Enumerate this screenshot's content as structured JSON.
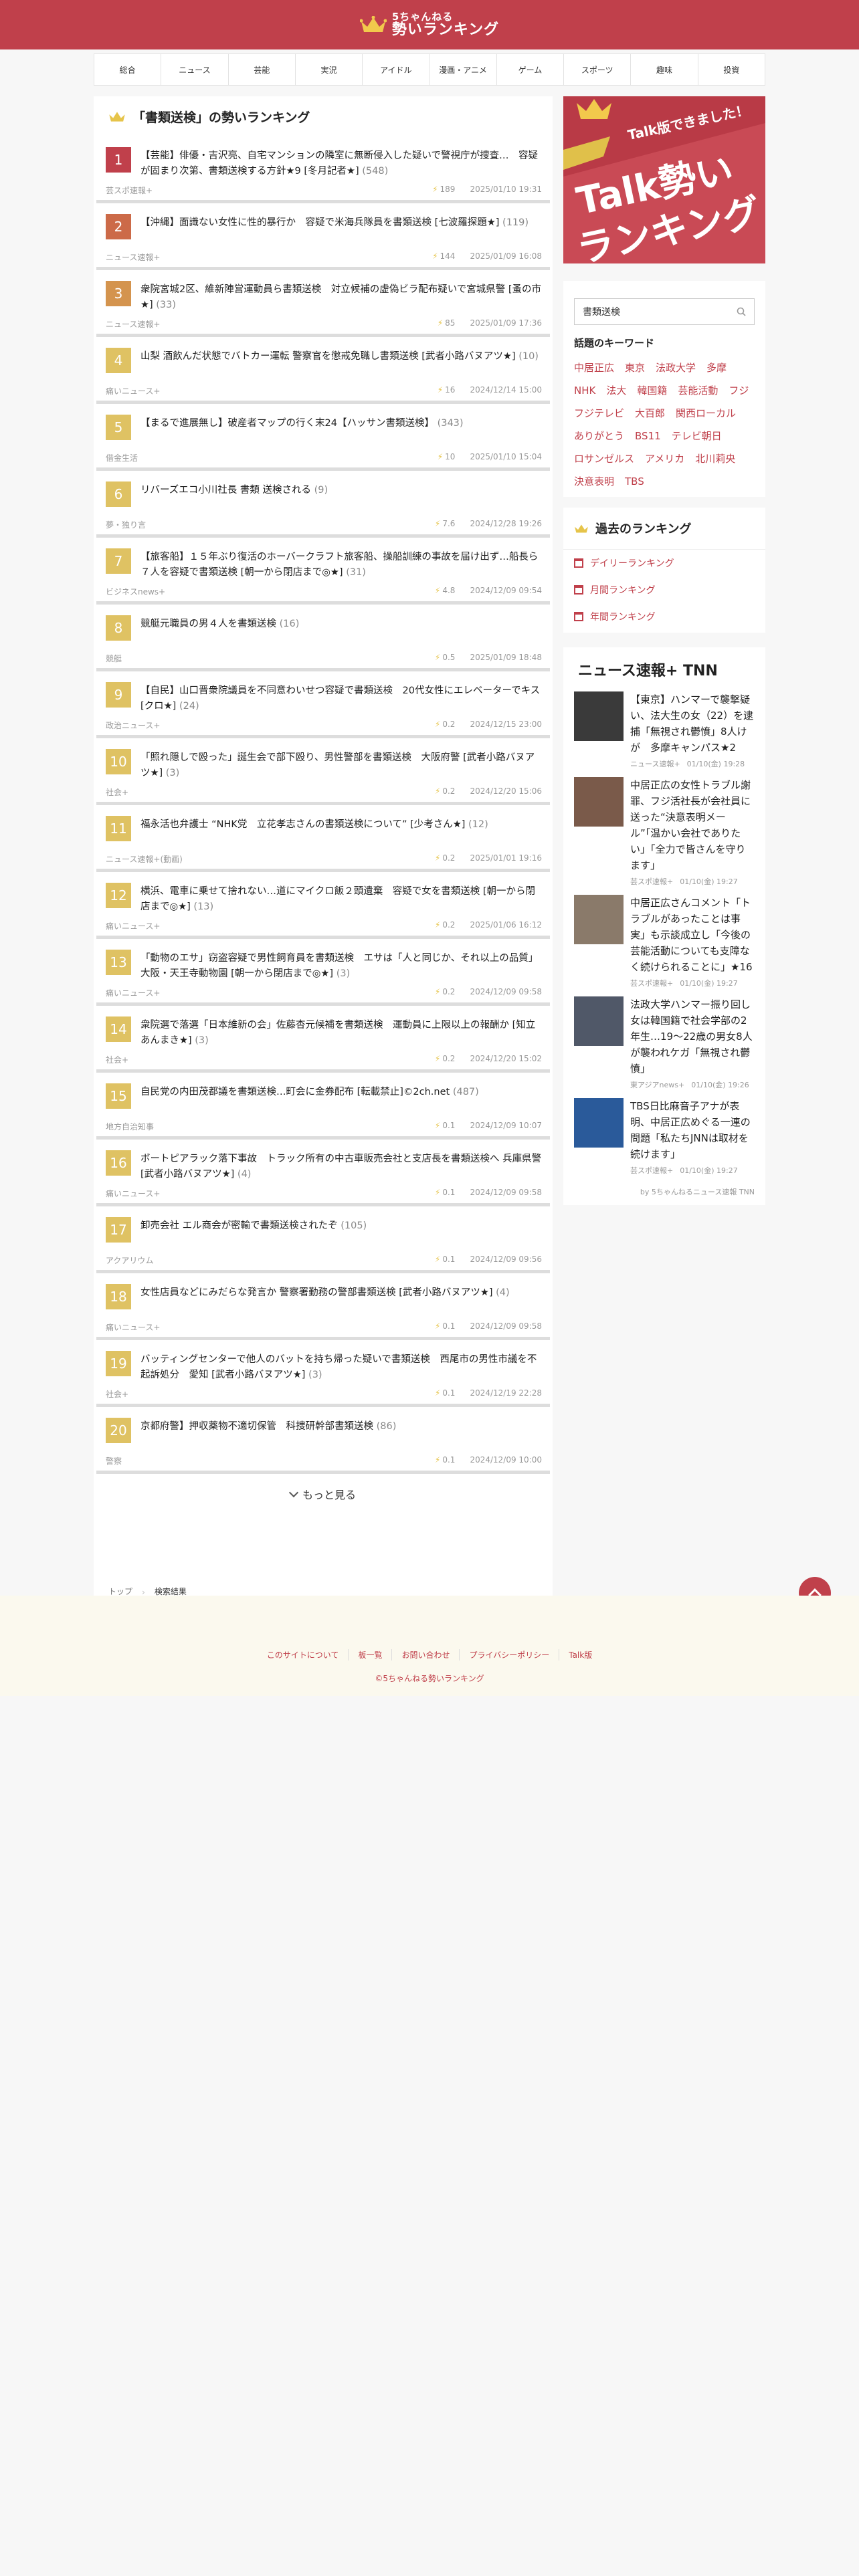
{
  "header": {
    "logo_sub": "5ちゃんねる",
    "logo_main": "勢いランキング"
  },
  "nav": [
    "総合",
    "ニュース",
    "芸能",
    "実況",
    "アイドル",
    "漫画・アニメ",
    "ゲーム",
    "スポーツ",
    "趣味",
    "投資"
  ],
  "main": {
    "title": "「書類送検」の勢いランキング",
    "items": [
      {
        "rank": "1",
        "color": "#c0404b",
        "title": "【芸能】俳優・吉沢亮、自宅マンションの隣室に無断侵入した疑いで警視庁が捜査…　容疑が固まり次第、書類送検する方針★9 [冬月記者★]",
        "count": "(548)",
        "board": "芸スポ速報+",
        "score": "189",
        "date": "2025/01/10 19:31"
      },
      {
        "rank": "2",
        "color": "#cc6a48",
        "title": "【沖縄】面識ない女性に性的暴行か　容疑で米海兵隊員を書類送検 [七波羅探題★]",
        "count": "(119)",
        "board": "ニュース速報+",
        "score": "144",
        "date": "2025/01/09 16:08"
      },
      {
        "rank": "3",
        "color": "#d4944e",
        "title": "衆院宮城2区、維新陣営運動員ら書類送検　対立候補の虚偽ビラ配布疑いで宮城県警 [蚤の市★]",
        "count": "(33)",
        "board": "ニュース速報+",
        "score": "85",
        "date": "2025/01/09 17:36"
      },
      {
        "rank": "4",
        "color": "#dfc263",
        "title": "山梨 酒飲んだ状態でバトカー運転 警察官を懲戒免職し書類送検 [武者小路バヌアツ★]",
        "count": "(10)",
        "board": "痛いニュース+",
        "score": "16",
        "date": "2024/12/14 15:00"
      },
      {
        "rank": "5",
        "color": "#dfc263",
        "title": "【まるで進展無し】破産者マップの行く末24【ハッサン書類送検】",
        "count": "(343)",
        "board": "借金生活",
        "score": "10",
        "date": "2025/01/10 15:04"
      },
      {
        "rank": "6",
        "color": "#dfc263",
        "title": "リバーズエコ小川社長 書類 送検される",
        "count": "(9)",
        "board": "夢・独り言",
        "score": "7.6",
        "date": "2024/12/28 19:26"
      },
      {
        "rank": "7",
        "color": "#dfc263",
        "title": "【旅客船】１５年ぶり復活のホーバークラフト旅客船、操船訓練の事故を届け出ず…船長ら７人を容疑で書類送検 [朝一から閉店まで◎★]",
        "count": "(31)",
        "board": "ビジネスnews+",
        "score": "4.8",
        "date": "2024/12/09 09:54"
      },
      {
        "rank": "8",
        "color": "#dfc263",
        "title": "競艇元職員の男４人を書類送検",
        "count": "(16)",
        "board": "競艇",
        "score": "0.5",
        "date": "2025/01/09 18:48"
      },
      {
        "rank": "9",
        "color": "#dfc263",
        "title": "【自民】山口晋衆院議員を不同意わいせつ容疑で書類送検　20代女性にエレベーターでキス [クロ★]",
        "count": "(24)",
        "board": "政治ニュース+",
        "score": "0.2",
        "date": "2024/12/15 23:00"
      },
      {
        "rank": "10",
        "color": "#dfc263",
        "title": "「照れ隠しで殴った」誕生会で部下殴り、男性警部を書類送検　大阪府警 [武者小路バヌアツ★]",
        "count": "(3)",
        "board": "社会+",
        "score": "0.2",
        "date": "2024/12/20 15:06"
      },
      {
        "rank": "11",
        "color": "#dfc263",
        "title": "福永活也弁護士 “NHK党　立花孝志さんの書類送検について” [少考さん★]",
        "count": "(12)",
        "board": "ニュース速報+(動画)",
        "score": "0.2",
        "date": "2025/01/01 19:16"
      },
      {
        "rank": "12",
        "color": "#dfc263",
        "title": "横浜、電車に乗せて捨れない…道にマイクロ飯２頭遺棄　容疑で女を書類送検 [朝一から閉店まで◎★]",
        "count": "(13)",
        "board": "痛いニュース+",
        "score": "0.2",
        "date": "2025/01/06 16:12"
      },
      {
        "rank": "13",
        "color": "#dfc263",
        "title": "「動物のエサ」窃盗容疑で男性飼育員を書類送検　エサは「人と同じか、それ以上の品質」　大阪・天王寺動物園 [朝一から閉店まで◎★]",
        "count": "(3)",
        "board": "痛いニュース+",
        "score": "0.2",
        "date": "2024/12/09 09:58"
      },
      {
        "rank": "14",
        "color": "#dfc263",
        "title": "衆院選で落選「日本維新の会」佐藤杏元候補を書類送検　運動員に上限以上の報酬か [知立あんまき★]",
        "count": "(3)",
        "board": "社会+",
        "score": "0.2",
        "date": "2024/12/20 15:02"
      },
      {
        "rank": "15",
        "color": "#dfc263",
        "title": "自民党の内田茂都議を書類送検…町会に金券配布 [転載禁止]©2ch.net",
        "count": "(487)",
        "board": "地方自治知事",
        "score": "0.1",
        "date": "2024/12/09 10:07"
      },
      {
        "rank": "16",
        "color": "#dfc263",
        "title": "ボートピアラック落下事故　トラック所有の中古車販売会社と支店長を書類送検へ 兵庫県警 [武者小路バヌアツ★]",
        "count": "(4)",
        "board": "痛いニュース+",
        "score": "0.1",
        "date": "2024/12/09 09:58"
      },
      {
        "rank": "17",
        "color": "#dfc263",
        "title": "卸売会社 エル商会が密輸で書類送検されたぞ",
        "count": "(105)",
        "board": "アクアリウム",
        "score": "0.1",
        "date": "2024/12/09 09:56"
      },
      {
        "rank": "18",
        "color": "#dfc263",
        "title": "女性店員などにみだらな発言か 警察署勤務の警部書類送検 [武者小路バヌアツ★]",
        "count": "(4)",
        "board": "痛いニュース+",
        "score": "0.1",
        "date": "2024/12/09 09:58"
      },
      {
        "rank": "19",
        "color": "#dfc263",
        "title": "バッティングセンターで他人のバットを持ち帰った疑いで書類送検　西尾市の男性市議を不起訴処分　愛知 [武者小路バヌアツ★]",
        "count": "(3)",
        "board": "社会+",
        "score": "0.1",
        "date": "2024/12/19 22:28"
      },
      {
        "rank": "20",
        "color": "#dfc263",
        "title": "京都府警】押収薬物不適切保管　科捜研幹部書類送検",
        "count": "(86)",
        "board": "警察",
        "score": "0.1",
        "date": "2024/12/09 10:00"
      }
    ],
    "more_label": "もっと見る"
  },
  "breadcrumb": {
    "home": "トップ",
    "current": "検索結果"
  },
  "side": {
    "banner_line1": "Talk版できました！",
    "banner_line2": "Talk勢い",
    "banner_line3": "ランキング",
    "search_value": "書類送検",
    "keywords_title": "話題のキーワード",
    "keywords": [
      "中居正広",
      "東京",
      "法政大学",
      "多摩",
      "NHK",
      "法大",
      "韓国籍",
      "芸能活動",
      "フジ",
      "フジテレビ",
      "大百郎",
      "関西ローカル",
      "ありがとう",
      "BS11",
      "テレビ朝日",
      "ロサンゼルス",
      "アメリカ",
      "北川莉央",
      "決意表明",
      "TBS"
    ],
    "past_title": "過去のランキング",
    "past_items": [
      "デイリーランキング",
      "月間ランキング",
      "年間ランキング"
    ],
    "news_title": "ニュース速報+ TNN",
    "news": [
      {
        "text": "【東京】ハンマーで襲撃疑い、法大生の女（22）を逮捕「無視され鬱憤」8人けが　多摩キャンパス★2",
        "board": "ニュース速報+",
        "date": "01/10(金) 19:28",
        "thumb": "#3a3a3a"
      },
      {
        "text": "中居正広の女性トラブル謝罪、フジ活社長が会社員に送った“決意表明メール”「温かい会社でありたい」「全力で皆さんを守ります」",
        "board": "芸スポ速報+",
        "date": "01/10(金) 19:27",
        "thumb": "#7a5a4a"
      },
      {
        "text": "中居正広さんコメント「トラブルがあったことは事実」も示談成立し「今後の芸能活動についても支障なく続けられることに」★16",
        "board": "芸スポ速報+",
        "date": "01/10(金) 19:27",
        "thumb": "#8a7a6a"
      },
      {
        "text": "法政大学ハンマー振り回し女は韓国籍で社会学部の2年生…19〜22歳の男女8人が襲われケガ「無視され鬱憤」",
        "board": "東アジアnews+",
        "date": "01/10(金) 19:26",
        "thumb": "#505868"
      },
      {
        "text": "TBS日比麻音子アナが表明、中居正広めぐる一連の問題「私たちJNNは取材を続けます」",
        "board": "芸スポ速報+",
        "date": "01/10(金) 19:27",
        "thumb": "#2a5a9a"
      }
    ],
    "news_by": "by 5ちゃんねるニュース速報 TNN"
  },
  "footer": {
    "links": [
      "このサイトについて",
      "板一覧",
      "お問い合わせ",
      "プライバシーポリシー",
      "Talk版"
    ],
    "copy": "©5ちゃんねる勢いランキング"
  },
  "colors": {
    "brand": "#c0404b",
    "bolt": "#e6c44a"
  }
}
